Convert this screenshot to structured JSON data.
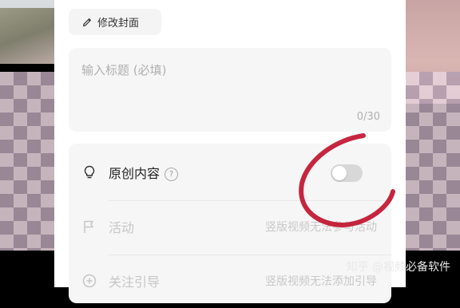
{
  "cover": {
    "edit_label": "修改封面"
  },
  "title_field": {
    "placeholder": "输入标题 (必填)",
    "counter": "0/30"
  },
  "options": {
    "original": {
      "label": "原创内容",
      "help": "?",
      "toggle_on": false
    },
    "activity": {
      "label": "活动",
      "status": "竖版视频无法参与活动"
    },
    "follow": {
      "label": "关注引导",
      "status": "竖版视频无法添加引导"
    }
  },
  "annotation": {
    "color": "#c0102a"
  },
  "watermark": "知乎 @视频必备软件"
}
